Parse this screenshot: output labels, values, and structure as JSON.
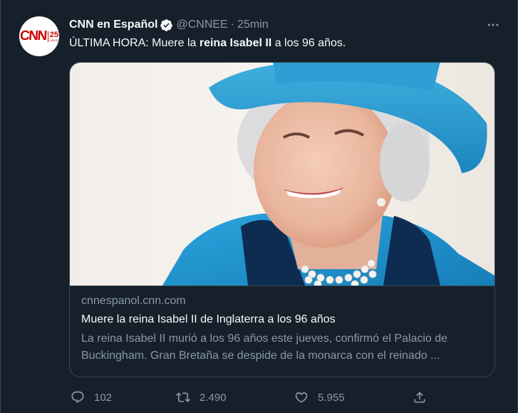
{
  "account": {
    "display_name": "CNN en Español",
    "handle": "@CNNEE",
    "separator": "·",
    "time": "25min",
    "avatar_logo": "CNN",
    "avatar_anniversary": "25",
    "avatar_anniversary_sub": "AÑOS",
    "verified_icon": "verified-badge-icon"
  },
  "tweet": {
    "text_before": "ÚLTIMA HORA: Muere la ",
    "text_bold": "reina Isabel II",
    "text_after": " a los 96 años."
  },
  "card": {
    "image_alt": "Photo of Queen Elizabeth II smiling, wearing a blue hat and pearl necklace",
    "domain": "cnnespanol.cnn.com",
    "title": "Muere la reina Isabel II de Inglaterra a los 96 años",
    "description": "La reina Isabel II murió a los 96 años este jueves, confirmó el Palacio de Buckingham. Gran Bretaña se despide de la monarca con el reinado ..."
  },
  "actions": {
    "replies": "102",
    "retweets": "2.490",
    "likes": "5.955"
  },
  "colors": {
    "background": "#15202b",
    "border": "#38444d",
    "primary_text": "#f7f9f9",
    "secondary_text": "#8b98a5",
    "verified": "#f7f9f9",
    "brand_red": "#cc0000"
  }
}
